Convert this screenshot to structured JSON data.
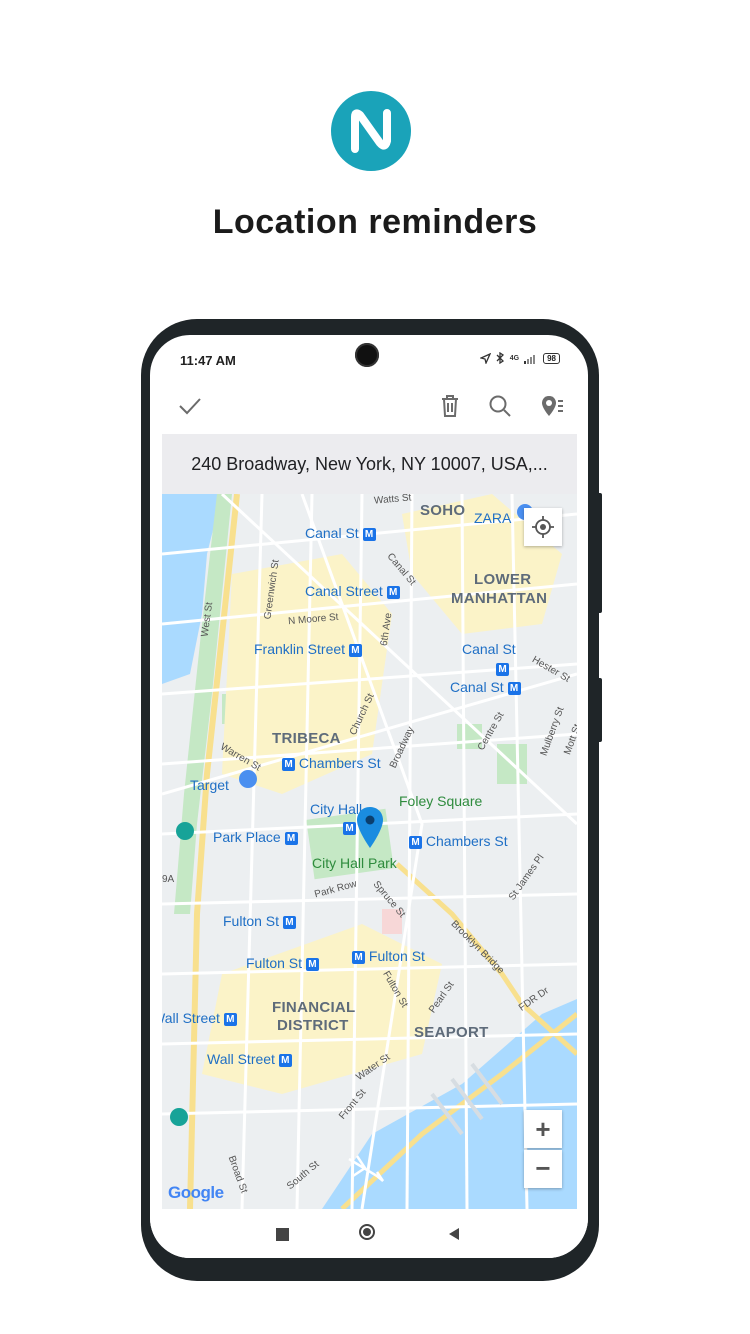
{
  "promo": {
    "headline": "Location reminders"
  },
  "status_bar": {
    "time": "11:47 AM",
    "network": "4G",
    "battery": "98"
  },
  "toolbar": {
    "done_icon": "check-icon",
    "delete_icon": "trash-icon",
    "search_icon": "search-icon",
    "location_list_icon": "location-list-icon"
  },
  "address": {
    "text": "240 Broadway, New York, NY 10007, USA,..."
  },
  "map": {
    "districts": {
      "soho": "SOHO",
      "lower_manhattan_1": "LOWER",
      "lower_manhattan_2": "MANHATTAN",
      "tribeca": "TRIBECA",
      "financial_1": "FINANCIAL",
      "financial_2": "DISTRICT",
      "seaport": "SEAPORT"
    },
    "stations": {
      "canal_st_1": "Canal St",
      "canal_street": "Canal Street",
      "franklin_street": "Franklin Street",
      "canal_st_2": "Canal St",
      "canal_st_3": "Canal St",
      "chambers_st_1": "Chambers St",
      "city_hall": "City Hall",
      "park_place": "Park Place",
      "chambers_st_2": "Chambers St",
      "fulton_st_1": "Fulton St",
      "fulton_st_2": "Fulton St",
      "fulton_st_3": "Fulton St",
      "wall_street_1": "Wall Street",
      "wall_street_2": "Wall Street"
    },
    "streets": {
      "watts": "Watts St",
      "west": "West St",
      "greenwich": "Greenwich St",
      "n_moore": "N Moore St",
      "canal": "Canal St",
      "sixth_ave": "6th Ave",
      "church": "Church St",
      "broadway": "Broadway",
      "warren": "Warren St",
      "hester": "Hester St",
      "centre": "Centre St",
      "mulberry": "Mulberry St",
      "mott": "Mott St",
      "park_row": "Park Row",
      "spruce": "Spruce St",
      "st_james": "St James Pl",
      "brooklyn_bridge": "Brooklyn Bridge",
      "fulton": "Fulton St",
      "pearl": "Pearl St",
      "fdr": "FDR Dr",
      "water": "Water St",
      "front": "Front St",
      "broad": "Broad St",
      "south": "South St",
      "route_9a": "9A"
    },
    "places": {
      "zara": "ZARA",
      "target": "Target",
      "foley_square": "Foley Square",
      "city_hall_park": "City Hall Park"
    },
    "metro_symbol": "M",
    "zoom_in": "+",
    "zoom_out": "−",
    "attribution": "Google",
    "accent_color": "#1a73e8",
    "water_color": "#aadaff",
    "park_color": "#c5e8c5"
  },
  "nav": {
    "recents_icon": "square-icon",
    "home_icon": "circle-icon",
    "back_icon": "triangle-back-icon"
  },
  "brand": {
    "logo_icon": "nimbus-note-logo",
    "color": "#1aa3b9"
  }
}
